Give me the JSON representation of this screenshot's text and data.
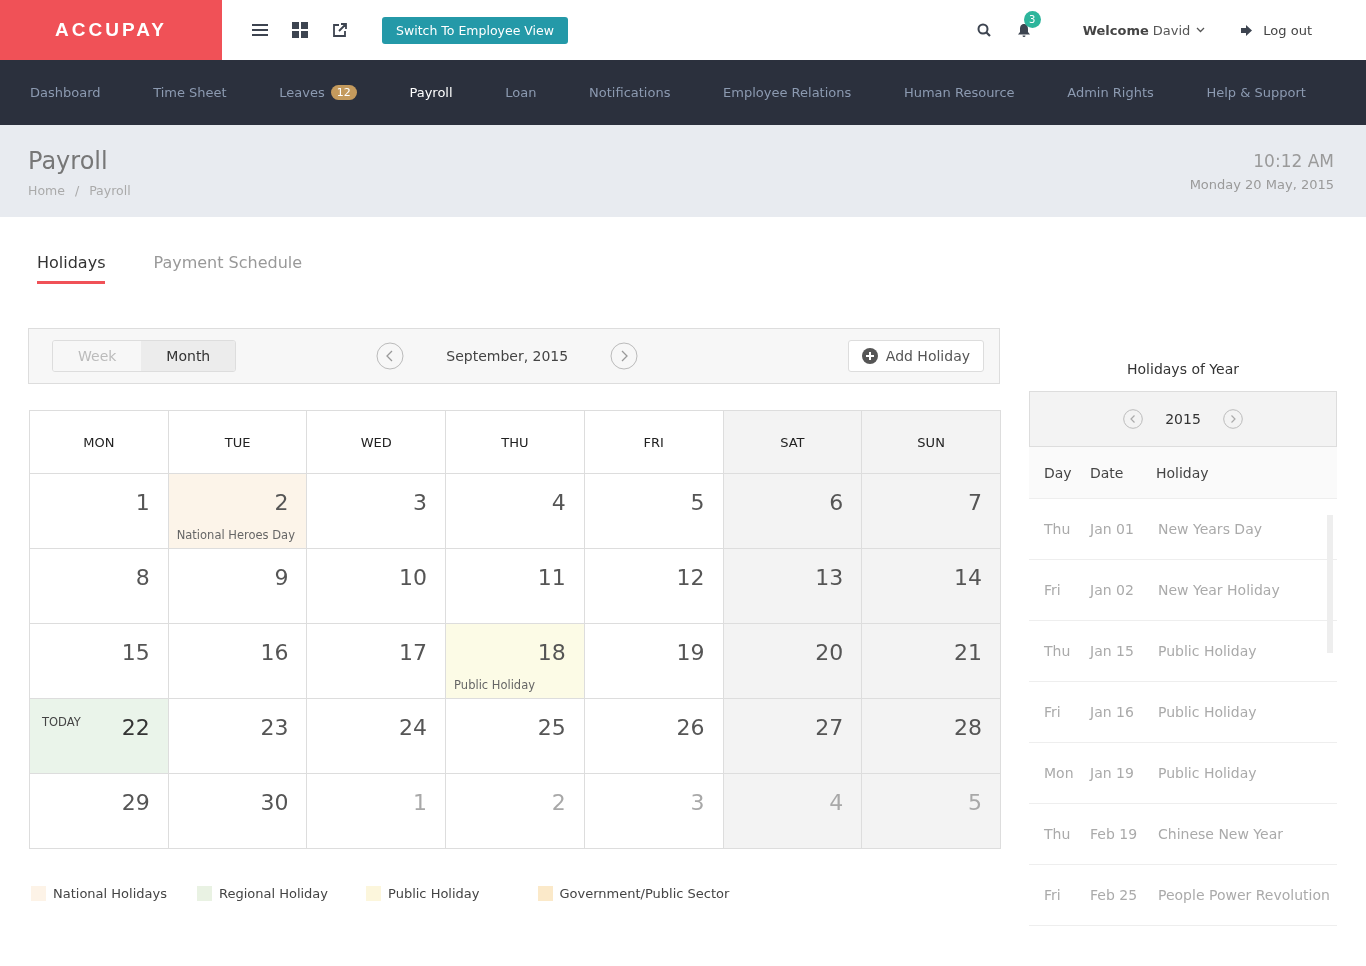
{
  "brand": "ACCUPAY",
  "switch_button": "Switch To Employee View",
  "notifications": {
    "count": "3"
  },
  "user": {
    "welcome": "Welcome",
    "name": "David"
  },
  "logout": "Log out",
  "nav": [
    {
      "label": "Dashboard",
      "selected": false
    },
    {
      "label": "Time Sheet",
      "selected": false
    },
    {
      "label": "Leaves",
      "selected": false,
      "badge": "12"
    },
    {
      "label": "Payroll",
      "selected": true
    },
    {
      "label": "Loan",
      "selected": false
    },
    {
      "label": "Notifications",
      "selected": false
    },
    {
      "label": "Employee Relations",
      "selected": false
    },
    {
      "label": "Human Resource",
      "selected": false
    },
    {
      "label": "Admin Rights",
      "selected": false
    },
    {
      "label": "Help & Support",
      "selected": false
    }
  ],
  "page": {
    "title": "Payroll",
    "breadcrumb": [
      "Home",
      "/",
      "Payroll"
    ],
    "time": "10:12 AM",
    "date": "Monday 20 May, 2015"
  },
  "tabs": [
    {
      "label": "Holidays",
      "selected": true
    },
    {
      "label": "Payment Schedule",
      "selected": false
    }
  ],
  "calendar": {
    "views": [
      {
        "label": "Week",
        "selected": false
      },
      {
        "label": "Month",
        "selected": true
      }
    ],
    "month": "September, 2015",
    "add_button": "Add Holiday",
    "columns": [
      {
        "label": "MON",
        "weekend": false
      },
      {
        "label": "TUE",
        "weekend": false
      },
      {
        "label": "WED",
        "weekend": false
      },
      {
        "label": "THU",
        "weekend": false
      },
      {
        "label": "FRI",
        "weekend": false
      },
      {
        "label": "SAT",
        "weekend": true
      },
      {
        "label": "SUN",
        "weekend": true
      }
    ],
    "weeks": [
      [
        {
          "day": "1"
        },
        {
          "day": "2",
          "color": "#fcf4e9",
          "event": "National Heroes Day"
        },
        {
          "day": "3"
        },
        {
          "day": "4"
        },
        {
          "day": "5"
        },
        {
          "day": "6"
        },
        {
          "day": "7"
        }
      ],
      [
        {
          "day": "8"
        },
        {
          "day": "9"
        },
        {
          "day": "10"
        },
        {
          "day": "11"
        },
        {
          "day": "12"
        },
        {
          "day": "13"
        },
        {
          "day": "14"
        }
      ],
      [
        {
          "day": "15"
        },
        {
          "day": "16"
        },
        {
          "day": "17"
        },
        {
          "day": "18",
          "color": "#fcfbe6",
          "event": "Public Holiday"
        },
        {
          "day": "19"
        },
        {
          "day": "20"
        },
        {
          "day": "21"
        }
      ],
      [
        {
          "day": "22",
          "today": "TODAY",
          "color": "#eaf4ea"
        },
        {
          "day": "23"
        },
        {
          "day": "24"
        },
        {
          "day": "25"
        },
        {
          "day": "26"
        },
        {
          "day": "27"
        },
        {
          "day": "28"
        }
      ],
      [
        {
          "day": "29"
        },
        {
          "day": "30"
        },
        {
          "day": "1",
          "outside": true
        },
        {
          "day": "2",
          "outside": true
        },
        {
          "day": "3",
          "outside": true
        },
        {
          "day": "4",
          "outside": true
        },
        {
          "day": "5",
          "outside": true
        }
      ]
    ]
  },
  "legend": [
    {
      "label": "National Holidays",
      "color": "#fdf3e7"
    },
    {
      "label": "Regional Holiday",
      "color": "#e9f2e3"
    },
    {
      "label": "Public Holiday",
      "color": "#fcf6dc"
    },
    {
      "label": "Government/Public Sector",
      "color": "#fbe9c9"
    }
  ],
  "holidays": {
    "title": "Holidays of Year",
    "year": "2015",
    "columns": [
      "Day",
      "Date",
      "Holiday"
    ],
    "rows": [
      [
        "Thu",
        "Jan 01",
        "New Years Day"
      ],
      [
        "Fri",
        "Jan 02",
        "New Year Holiday"
      ],
      [
        "Thu",
        "Jan 15",
        "Public Holiday"
      ],
      [
        "Fri",
        "Jan 16",
        "Public Holiday"
      ],
      [
        "Mon",
        "Jan 19",
        "Public Holiday"
      ],
      [
        "Thu",
        "Feb 19",
        "Chinese New Year"
      ],
      [
        "Fri",
        "Feb 25",
        "People Power Revolution"
      ]
    ]
  }
}
